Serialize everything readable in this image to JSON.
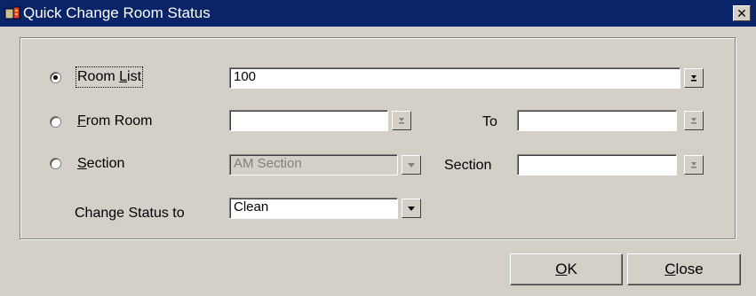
{
  "window": {
    "title": "Quick Change Room Status",
    "close_glyph": "✕"
  },
  "room_list": {
    "selected": true,
    "label_pre": "Room ",
    "label_mnemonic": "L",
    "label_post": "ist",
    "value": "100"
  },
  "from_room": {
    "selected": false,
    "label_mnemonic": "F",
    "label_post": "rom Room",
    "value": "",
    "to_label": "To",
    "to_value": ""
  },
  "section": {
    "selected": false,
    "label_mnemonic": "S",
    "label_post": "ection",
    "value": "AM Section",
    "section_label": "Section",
    "section_value": ""
  },
  "change_status": {
    "label": "Change Status to",
    "value": "Clean"
  },
  "buttons": {
    "ok_mnemonic": "O",
    "ok_post": "K",
    "close_mnemonic": "C",
    "close_post": "lose"
  },
  "icons": {
    "title": "hotel-app-icon",
    "lov": "lov-arrow-icon",
    "dropdown": "dropdown-arrow-icon"
  },
  "colors": {
    "titlebar": "#0a246a",
    "face": "#d4d0c8",
    "disabled_text": "#808080"
  }
}
